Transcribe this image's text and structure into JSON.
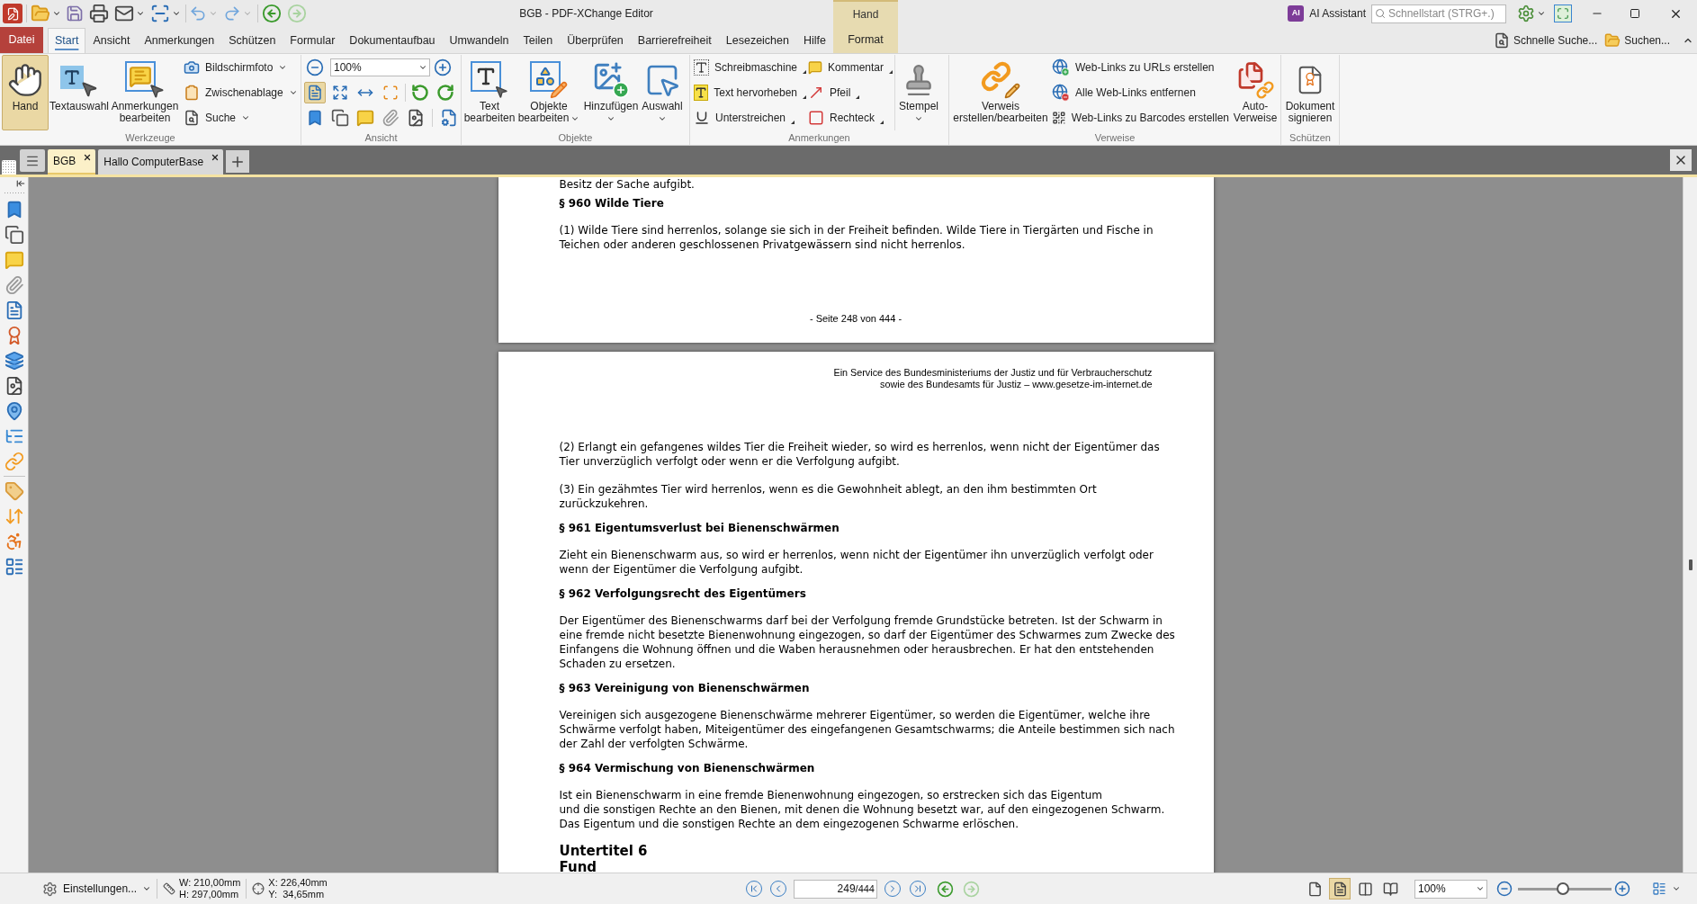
{
  "window": {
    "title": "BGB - PDF-XChange Editor",
    "history": [
      {
        "kind": "back",
        "disabled": false
      },
      {
        "kind": "forward",
        "disabled": true
      }
    ],
    "ai_assistant": {
      "badge": "AI",
      "label": "AI Assistant"
    },
    "quick_launch": {
      "placeholder": "Schnellstart (STRG+.)"
    }
  },
  "contextual_tab": {
    "group": "Hand",
    "label": "Format",
    "selected": false
  },
  "ribbon_tabs": [
    {
      "label": "Datei",
      "kind": "file",
      "selected": false
    },
    {
      "label": "Start",
      "kind": "tab",
      "selected": true
    },
    {
      "label": "Ansicht",
      "kind": "tab",
      "selected": false
    },
    {
      "label": "Anmerkungen",
      "kind": "tab",
      "selected": false
    },
    {
      "label": "Schützen",
      "kind": "tab",
      "selected": false
    },
    {
      "label": "Formular",
      "kind": "tab",
      "selected": false
    },
    {
      "label": "Dokumentaufbau",
      "kind": "tab",
      "selected": false
    },
    {
      "label": "Umwandeln",
      "kind": "tab",
      "selected": false
    },
    {
      "label": "Teilen",
      "kind": "tab",
      "selected": false
    },
    {
      "label": "Überprüfen",
      "kind": "tab",
      "selected": false
    },
    {
      "label": "Barrierefreiheit",
      "kind": "tab",
      "selected": false
    },
    {
      "label": "Lesezeichen",
      "kind": "tab",
      "selected": false
    },
    {
      "label": "Hilfe",
      "kind": "tab",
      "selected": false
    }
  ],
  "ribbon_tools": [
    "Schnelle Suche...",
    "Suchen..."
  ],
  "ribbon": [
    {
      "kind": "tools",
      "label": "Werkzeuge",
      "buttons": [
        {
          "lines": [
            "Hand"
          ],
          "selected": true
        },
        {
          "lines": [
            "Textauswahl"
          ],
          "selected": false
        },
        {
          "lines": [
            "Anmerkungen",
            "bearbeiten"
          ],
          "selected": false
        }
      ],
      "entries": [
        {
          "label": "Bildschirmfoto",
          "dropdown": true
        },
        {
          "label": "Zwischenablage",
          "dropdown": true
        },
        {
          "label": "Suche",
          "dropdown": true
        }
      ]
    },
    {
      "kind": "view",
      "label": "Ansicht",
      "zoom": "100%",
      "fit_buttons": [
        {
          "selected": true
        },
        {
          "selected": false
        },
        {
          "selected": false
        },
        {
          "selected": false
        }
      ]
    },
    {
      "kind": "objects",
      "label": "Objekte",
      "buttons": [
        {
          "lines": [
            "Text",
            "bearbeiten"
          ],
          "dropdown": false
        },
        {
          "lines": [
            "Objekte",
            "bearbeiten"
          ],
          "dropdown": true
        },
        {
          "lines": [
            "Hinzufügen"
          ],
          "dropdown": true
        },
        {
          "lines": [
            "Auswahl"
          ],
          "dropdown": true
        }
      ]
    },
    {
      "kind": "annotations",
      "label": "Anmerkungen",
      "entries": [
        {
          "label": "Schreibmaschine",
          "dropdown": true
        },
        {
          "label": "Text hervorheben",
          "dropdown": true
        },
        {
          "label": "Unterstreichen",
          "dropdown": true
        },
        {
          "label": "Kommentar",
          "dropdown": true
        },
        {
          "label": "Pfeil",
          "dropdown": true
        },
        {
          "label": "Rechteck",
          "dropdown": true
        }
      ],
      "buttons": [
        {
          "lines": [
            "Stempel"
          ],
          "dropdown": true
        }
      ]
    },
    {
      "kind": "links",
      "label": "Verweise",
      "buttons": [
        {
          "lines": [
            "Verweis",
            "erstellen/bearbeiten"
          ],
          "dropdown": false
        },
        {
          "lines": [
            "Auto-",
            "Verweise"
          ],
          "dropdown": false
        }
      ],
      "entries": [
        {
          "label": "Web-Links zu URLs erstellen",
          "dropdown": false
        },
        {
          "label": "Alle Web-Links entfernen",
          "dropdown": false
        },
        {
          "label": "Web-Links zu Barcodes erstellen",
          "dropdown": false
        }
      ]
    },
    {
      "kind": "protect",
      "label": "Schützen",
      "buttons": [
        {
          "lines": [
            "Dokument",
            "signieren"
          ],
          "dropdown": false
        }
      ]
    }
  ],
  "document_tabs": [
    {
      "label": "BGB",
      "selected": true
    },
    {
      "label": "Hallo ComputerBase",
      "selected": false
    }
  ],
  "pages": [
    {
      "blocks": [
        {
          "kind": "text",
          "lines": [
            "Besitz der Sache aufgibt."
          ]
        },
        {
          "kind": "heading",
          "text": "§ 960 Wilde Tiere"
        },
        {
          "kind": "text",
          "lines": [
            "(1) Wilde Tiere sind herrenlos, solange sie sich in der Freiheit befinden. Wilde Tiere in Tiergärten und Fische in",
            "Teichen oder anderen geschlossenen Privatgewässern sind nicht herrenlos."
          ]
        }
      ],
      "footer": "- Seite 248 von 444 -"
    },
    {
      "header": [
        "Ein Service des Bundesministeriums der Justiz und für Verbraucherschutz",
        "sowie des Bundesamts für Justiz – www.gesetze-im-internet.de"
      ],
      "blocks": [
        {
          "kind": "text",
          "lines": [
            "(2) Erlangt ein gefangenes wildes Tier die Freiheit wieder, so wird es herrenlos, wenn nicht der Eigentümer das",
            "Tier unverzüglich verfolgt oder wenn er die Verfolgung aufgibt."
          ]
        },
        {
          "kind": "text",
          "lines": [
            "(3) Ein gezähmtes Tier wird herrenlos, wenn es die Gewohnheit ablegt, an den ihm bestimmten Ort",
            "zurückzukehren."
          ]
        },
        {
          "kind": "heading",
          "text": "§ 961 Eigentumsverlust bei Bienenschwärmen"
        },
        {
          "kind": "text",
          "lines": [
            "Zieht ein Bienenschwarm aus, so wird er herrenlos, wenn nicht der Eigentümer ihn unverzüglich verfolgt oder",
            "wenn der Eigentümer die Verfolgung aufgibt."
          ]
        },
        {
          "kind": "heading",
          "text": "§ 962 Verfolgungsrecht des Eigentümers"
        },
        {
          "kind": "text",
          "lines": [
            "Der Eigentümer des Bienenschwarms darf bei der Verfolgung fremde Grundstücke betreten. Ist der Schwarm in",
            "eine fremde nicht besetzte Bienenwohnung eingezogen, so darf der Eigentümer des Schwarmes zum Zwecke des",
            "Einfangens die Wohnung öffnen und die Waben herausnehmen oder herausbrechen. Er hat den entstehenden",
            "Schaden zu ersetzen."
          ]
        },
        {
          "kind": "heading",
          "text": "§ 963 Vereinigung von Bienenschwärmen"
        },
        {
          "kind": "text",
          "lines": [
            "Vereinigen sich ausgezogene Bienenschwärme mehrerer Eigentümer, so werden die Eigentümer, welche ihre",
            "Schwärme verfolgt haben, Miteigentümer des eingefangenen Gesamtschwarms; die Anteile bestimmen sich nach",
            "der Zahl der verfolgten Schwärme."
          ]
        },
        {
          "kind": "heading",
          "text": "§ 964 Vermischung von Bienenschwärmen"
        },
        {
          "kind": "text",
          "lines": [
            "Ist ein Bienenschwarm in eine fremde Bienenwohnung eingezogen, so erstrecken sich das Eigentum",
            "und die sonstigen Rechte an den Bienen, mit denen die Wohnung besetzt war, auf den eingezogenen Schwarm.",
            "Das Eigentum und die sonstigen Rechte an dem eingezogenen Schwarme erlöschen."
          ]
        },
        {
          "kind": "title",
          "text": "Untertitel 6"
        },
        {
          "kind": "title",
          "text": "Fund"
        }
      ]
    }
  ],
  "status_bar": {
    "settings": "Einstellungen...",
    "size": [
      "W: 210,00mm",
      "H: 297,00mm"
    ],
    "cursor": [
      "X: 226,40mm",
      "Y:  34,65mm"
    ],
    "page": "249",
    "page_total": "/444",
    "history": [
      {
        "kind": "back",
        "disabled": false
      },
      {
        "kind": "forward",
        "disabled": true
      }
    ],
    "layouts": [
      {
        "selected": false
      },
      {
        "selected": true
      },
      {
        "selected": false
      },
      {
        "selected": false
      }
    ],
    "zoom": {
      "value": "100%",
      "level": 0.48
    }
  }
}
